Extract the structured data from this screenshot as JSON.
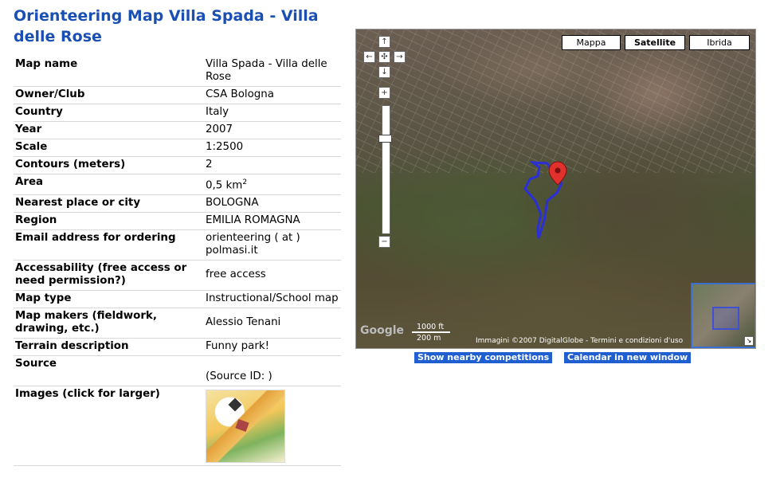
{
  "page_title": "Orienteering Map Villa Spada - Villa delle Rose",
  "rows": [
    {
      "label": "Map name",
      "value": "Villa Spada - Villa delle Rose"
    },
    {
      "label": "Owner/Club",
      "value": "CSA Bologna"
    },
    {
      "label": "Country",
      "value": "Italy"
    },
    {
      "label": "Year",
      "value": "2007"
    },
    {
      "label": "Scale",
      "value": "1:2500"
    },
    {
      "label": "Contours (meters)",
      "value": "2"
    },
    {
      "label": "Area",
      "value": "0,5 km",
      "unit_sup": "2"
    },
    {
      "label": "Nearest place or city",
      "value": "BOLOGNA"
    },
    {
      "label": "Region",
      "value": "EMILIA ROMAGNA"
    },
    {
      "label": "Email address for ordering",
      "value": "orienteering ( at ) polmasi.it"
    },
    {
      "label": "Accessability (free access or need permission?)",
      "value": "free access"
    },
    {
      "label": "Map type",
      "value": "Instructional/School map"
    },
    {
      "label": "Map makers (fieldwork, drawing, etc.)",
      "value": "Alessio Tenani"
    },
    {
      "label": "Terrain description",
      "value": "Funny park!"
    },
    {
      "label": "Source",
      "value": "(Source ID: )"
    },
    {
      "label": "Images (click for larger)",
      "value": ""
    }
  ],
  "map": {
    "type_buttons": [
      "Mappa",
      "Satellite",
      "Ibrida"
    ],
    "selected_type": "Satellite",
    "scale_ft": "1000 ft",
    "scale_m": "200 m",
    "logo_text": "Google",
    "copyright": "Immagini ©2007 DigitalGlobe - Termini e condizioni d'uso"
  },
  "links": {
    "nearby": "Show nearby competitions",
    "calendar": "Calendar in new window"
  },
  "colors": {
    "title": "#1a4fb3",
    "link_button": "#1f5fd0",
    "marker": "#e0312c",
    "route": "#2b2fd6"
  }
}
